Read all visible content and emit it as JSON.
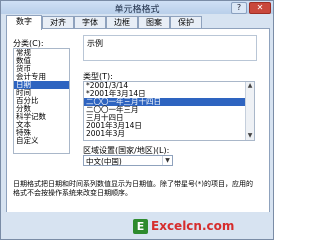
{
  "window": {
    "title": "单元格格式",
    "help_label": "?",
    "close_label": "✕"
  },
  "tabs": [
    {
      "label": "数字"
    },
    {
      "label": "对齐"
    },
    {
      "label": "字体"
    },
    {
      "label": "边框"
    },
    {
      "label": "图案"
    },
    {
      "label": "保护"
    }
  ],
  "category": {
    "label": "分类(C):",
    "items": [
      "常规",
      "数值",
      "货币",
      "会计专用",
      "日期",
      "时间",
      "百分比",
      "分数",
      "科学记数",
      "文本",
      "特殊",
      "自定义"
    ],
    "selected_index": 4
  },
  "sample": {
    "label": "示例",
    "value": ""
  },
  "type": {
    "label": "类型(T):",
    "items": [
      "*2001/3/14",
      "*2001年3月14日",
      "二〇〇一年三月十四日",
      "二〇〇一年三月",
      "三月十四日",
      "2001年3月14日",
      "2001年3月"
    ],
    "selected_index": 2
  },
  "locale": {
    "label": "区域设置(国家/地区)(L):",
    "value": "中文(中国)"
  },
  "description": "日期格式把日期和时间系列数值显示为日期值。除了带星号(*)的项目，应用的格式不会按操作系统来改变日期顺序。",
  "watermark": {
    "mark": "E",
    "text": "Excelcn.com"
  }
}
